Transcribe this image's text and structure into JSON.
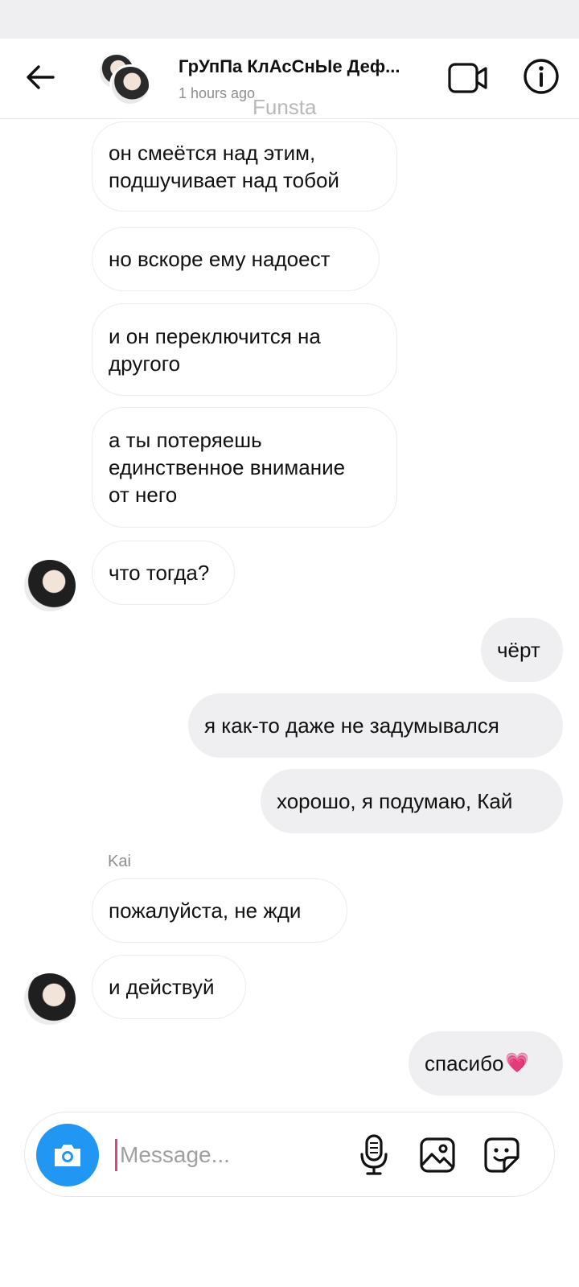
{
  "header": {
    "title": "ГрУпПа КлАсСнЫе Деф...",
    "subtitle": "1 hours ago",
    "watermark": "Funsta"
  },
  "messages": [
    {
      "text": "он смеётся над этим,\nподшучивает над тобой",
      "direction": "incoming"
    },
    {
      "text": "но вскоре  ему надоест",
      "direction": "incoming"
    },
    {
      "text": "и он переключится на\nдругого",
      "direction": "incoming"
    },
    {
      "text": "а ты потеряешь\nединственное внимание\nот него",
      "direction": "incoming"
    },
    {
      "text": "что тогда?",
      "direction": "incoming"
    },
    {
      "text": "чёрт",
      "direction": "outgoing"
    },
    {
      "text": "я как-то даже не задумывался",
      "direction": "outgoing"
    },
    {
      "text": "хорошо, я подумаю, Кай",
      "direction": "outgoing"
    },
    {
      "sender": "Kai"
    },
    {
      "text": "пожалуйста, не жди",
      "direction": "incoming"
    },
    {
      "text": "и действуй",
      "direction": "incoming"
    },
    {
      "text": "спасибо",
      "emoji": "💗",
      "direction": "outgoing"
    }
  ],
  "composer": {
    "placeholder": "Message..."
  },
  "icons": {
    "back": "arrow-left-icon",
    "video": "video-camera-icon",
    "info": "info-icon",
    "camera": "camera-icon",
    "mic": "microphone-icon",
    "gallery": "image-icon",
    "sticker": "sticker-icon"
  },
  "colors": {
    "camera_button": "#2196f3",
    "outgoing_bubble": "#efeff1",
    "caret": "#e0457a"
  }
}
